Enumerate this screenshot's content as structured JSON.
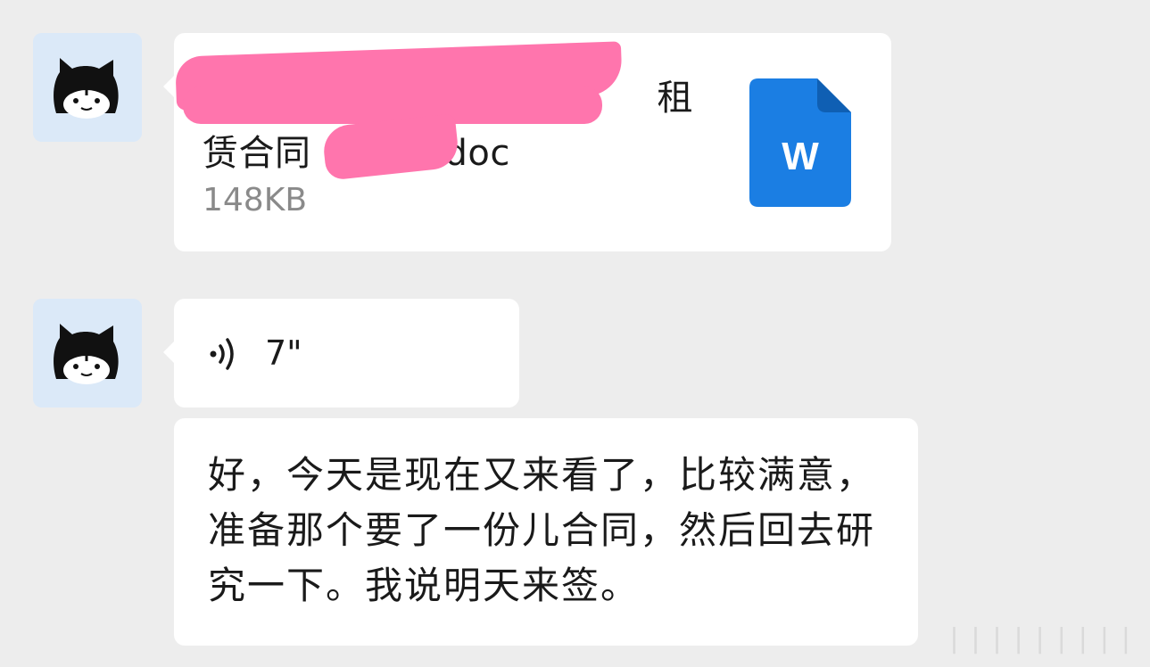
{
  "messages": {
    "file": {
      "name_visible_top": "租",
      "name_visible_bottom_left": "赁合同",
      "name_visible_bottom_right": "doc",
      "size": "148KB",
      "icon_letter": "W",
      "icon_color": "#1b7ee3",
      "icon": "word-document-icon"
    },
    "voice": {
      "duration": "7\"",
      "icon": "voice-wave-icon"
    },
    "transcript": {
      "text": "好，今天是现在又来看了，比较满意，准备那个要了一份儿合同，然后回去研究一下。我说明天来签。"
    }
  },
  "watermark": "|||||||||"
}
